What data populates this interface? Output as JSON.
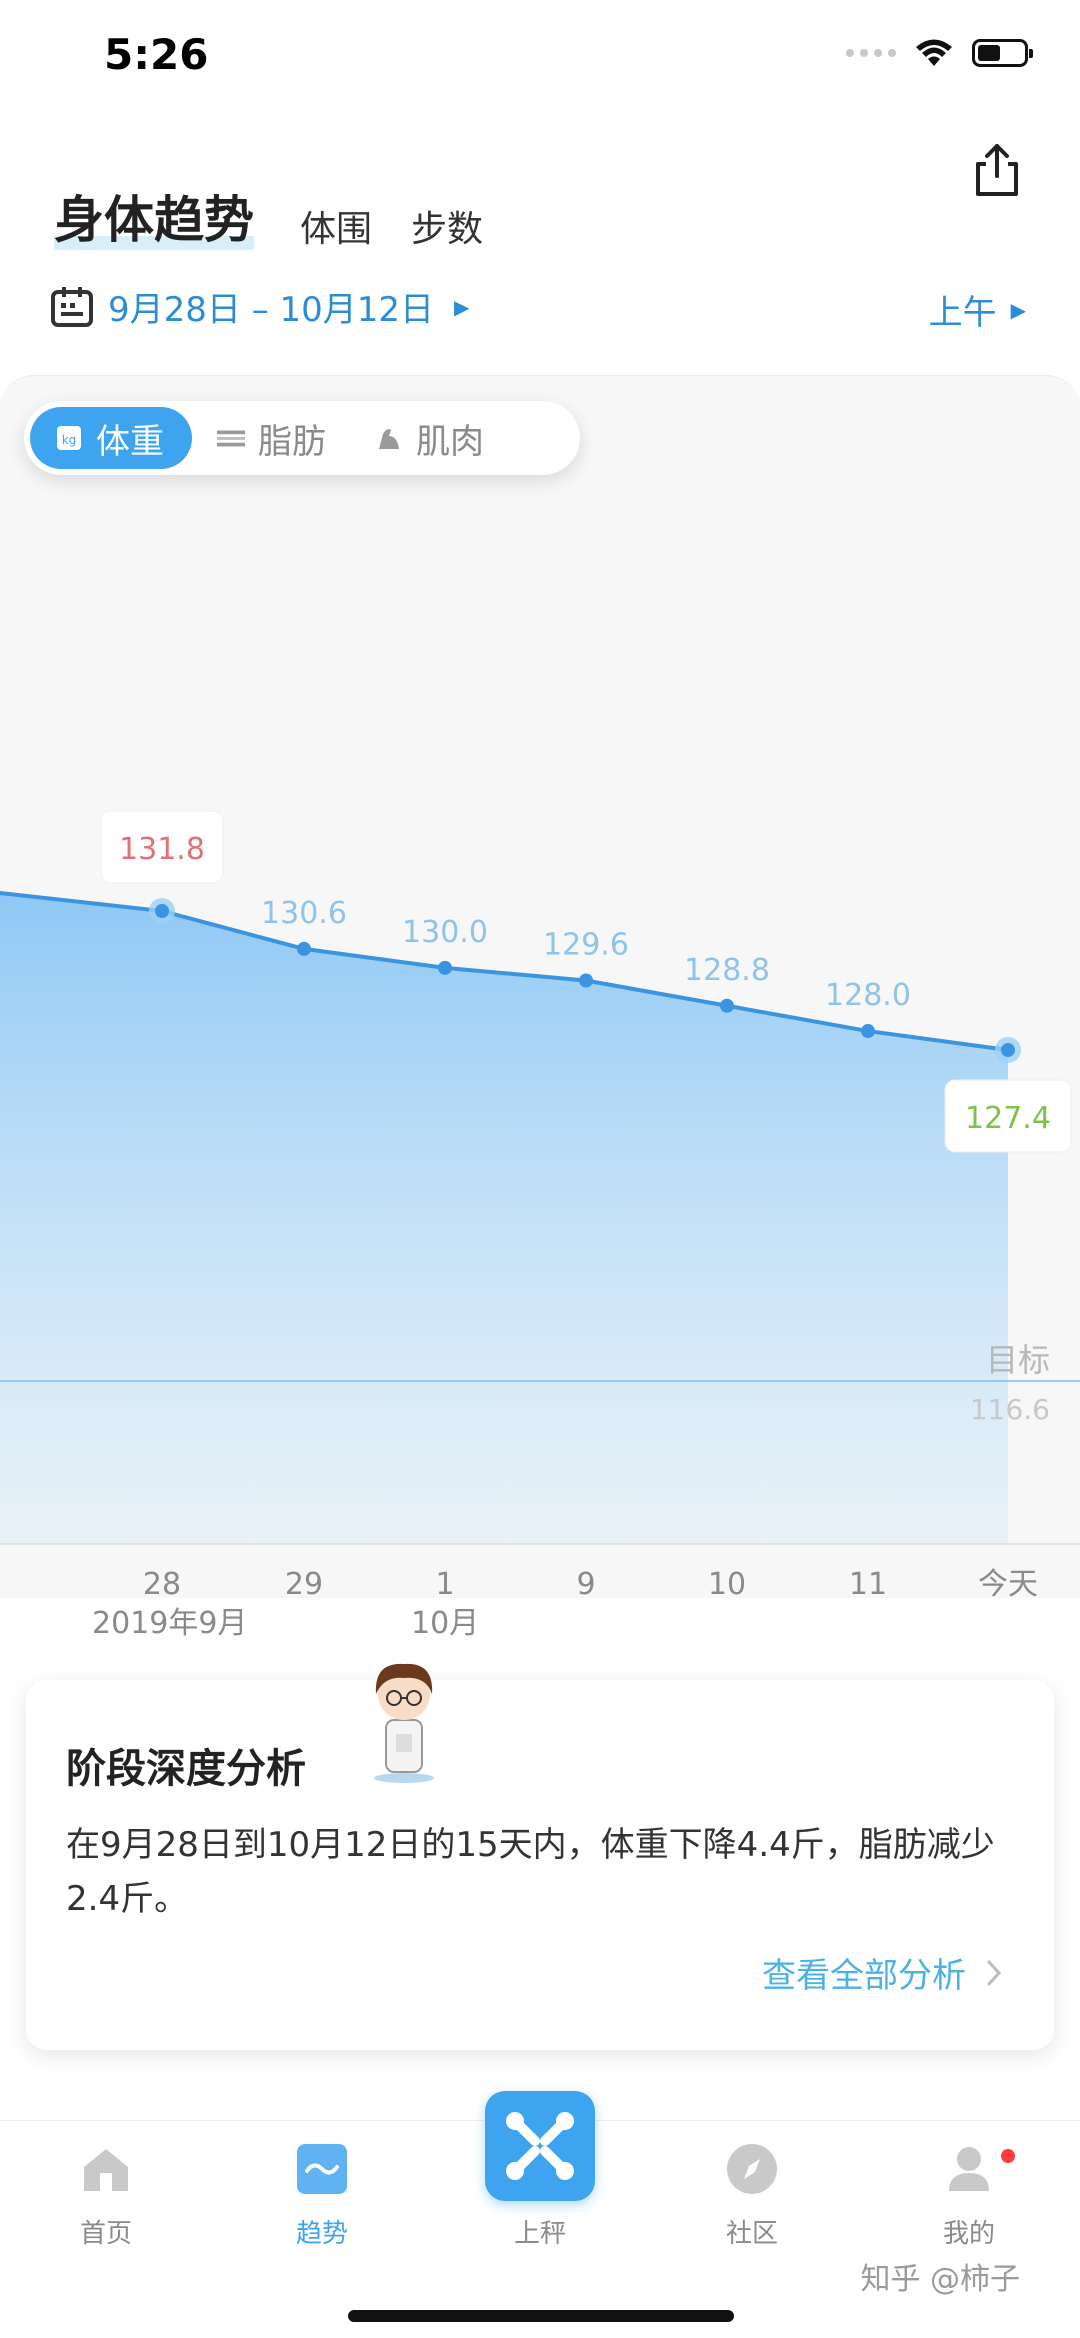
{
  "status": {
    "time": "5:26"
  },
  "header": {
    "title": "身体趋势",
    "tabs": [
      "体围",
      "步数"
    ],
    "date_range": "9月28日 – 10月12日",
    "period": "上午"
  },
  "metric_tabs": [
    "体重",
    "脂肪",
    "肌肉"
  ],
  "chart_data": {
    "type": "area",
    "x": [
      "28",
      "29",
      "1",
      "9",
      "10",
      "11",
      "今天"
    ],
    "x_month_labels": [
      "2019年9月",
      "10月"
    ],
    "values": [
      131.8,
      130.6,
      130.0,
      129.6,
      128.8,
      128.0,
      127.4
    ],
    "target_label": "目标",
    "target_value": 116.6,
    "colors": {
      "line": "#3a94e2",
      "fill": "#8ec8f5",
      "max_label": "#e2707a",
      "today_label": "#7cc34a",
      "point_label": "#8fc3e9"
    }
  },
  "analysis": {
    "title": "阶段深度分析",
    "text": "在9月28日到10月12日的15天内，体重下降4.4斤，脂肪减少2.4斤。",
    "link": "查看全部分析"
  },
  "nav": {
    "items": [
      {
        "label": "首页",
        "icon": "home-icon"
      },
      {
        "label": "趋势",
        "icon": "trend-icon"
      },
      {
        "label": "上秤",
        "icon": "scale-icon"
      },
      {
        "label": "社区",
        "icon": "compass-icon"
      },
      {
        "label": "我的",
        "icon": "profile-icon"
      }
    ]
  },
  "watermark": "知乎 @柿子"
}
